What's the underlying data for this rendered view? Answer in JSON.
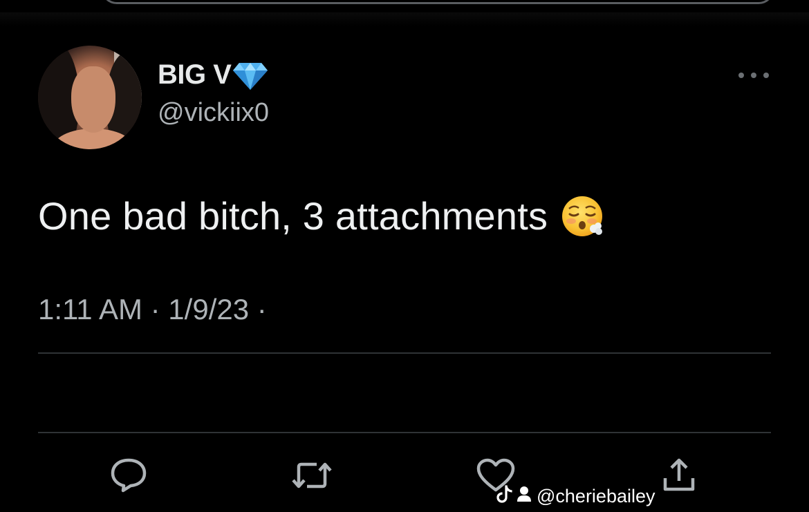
{
  "tweet": {
    "display_name": "BIG V",
    "verified_emoji": "gem-stone-icon",
    "handle": "@vickiix0",
    "text": "One bad bitch, 3 attachments",
    "text_emoji": "face-exhaling-emoji",
    "timestamp": "1:11 AM · 1/9/23 ·",
    "more_icon": "more-options-icon"
  },
  "actions": [
    {
      "name": "reply",
      "icon": "reply-icon"
    },
    {
      "name": "retweet",
      "icon": "retweet-icon"
    },
    {
      "name": "like",
      "icon": "heart-icon"
    },
    {
      "name": "share",
      "icon": "share-icon"
    }
  ],
  "watermark": {
    "platform_icon": "tiktok-icon",
    "user_icon": "person-icon",
    "username": "@cheriebailey"
  },
  "colors": {
    "background": "#000000",
    "text_primary": "#e7e9ea",
    "text_secondary": "#aeb3b7",
    "icon": "#aeb3b7",
    "divider": "#2f3336"
  }
}
